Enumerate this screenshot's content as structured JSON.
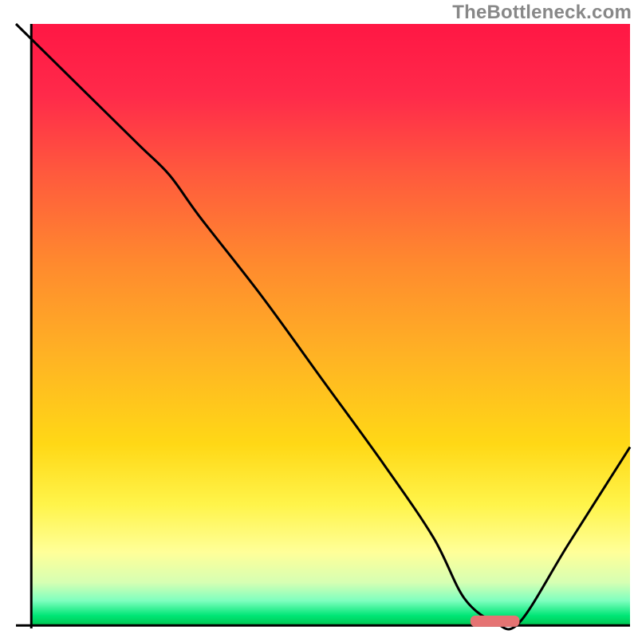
{
  "watermark": "TheBottleneck.com",
  "chart_data": {
    "type": "line",
    "title": "",
    "xlabel": "",
    "ylabel": "",
    "xlim": [
      0,
      100
    ],
    "ylim": [
      0,
      100
    ],
    "background_gradient_stops": [
      {
        "offset": 0.0,
        "color": "#ff1744"
      },
      {
        "offset": 0.12,
        "color": "#ff2a4a"
      },
      {
        "offset": 0.25,
        "color": "#ff5a3d"
      },
      {
        "offset": 0.4,
        "color": "#ff8a2e"
      },
      {
        "offset": 0.55,
        "color": "#ffb224"
      },
      {
        "offset": 0.7,
        "color": "#ffd816"
      },
      {
        "offset": 0.8,
        "color": "#fff44a"
      },
      {
        "offset": 0.88,
        "color": "#ffff99"
      },
      {
        "offset": 0.93,
        "color": "#d6ffb3"
      },
      {
        "offset": 0.96,
        "color": "#7fffbf"
      },
      {
        "offset": 0.985,
        "color": "#00e676"
      },
      {
        "offset": 1.0,
        "color": "#00c853"
      }
    ],
    "series": [
      {
        "name": "bottleneck-curve",
        "x": [
          0,
          10,
          20,
          25,
          30,
          40,
          50,
          60,
          68,
          73,
          78,
          82,
          90,
          100
        ],
        "y": [
          100,
          90,
          80,
          75,
          68,
          55,
          41,
          27,
          15,
          5,
          1,
          1,
          14,
          30
        ]
      }
    ],
    "marker": {
      "name": "optimal-range-marker",
      "x_start": 74,
      "x_end": 82,
      "y": 1.2,
      "color": "#e57373"
    },
    "axes": {
      "left": {
        "x": 2.5,
        "y1": 0,
        "y2": 100
      },
      "bottom": {
        "y": 0.5,
        "x1": 0,
        "x2": 100
      }
    }
  }
}
